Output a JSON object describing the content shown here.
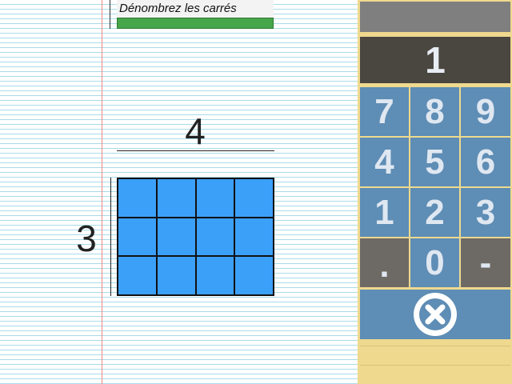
{
  "worksheet": {
    "instruction": "Dénombrez les carrés",
    "columns_label": "4",
    "rows_label": "3",
    "grid": {
      "rows": 3,
      "cols": 4
    }
  },
  "keypad": {
    "display_value": "1",
    "keys": [
      "7",
      "8",
      "9",
      "4",
      "5",
      "6",
      "1",
      "2",
      "3",
      ".",
      "0",
      "-"
    ],
    "clear_icon": "close-circle-icon"
  },
  "colors": {
    "grid_fill": "#3ba0f7",
    "key_blue": "#5e8db5",
    "key_gray": "#6d6a66",
    "panel_bg": "#efd98f",
    "display_bg": "#4a4640",
    "progress_green": "#46a64a"
  }
}
